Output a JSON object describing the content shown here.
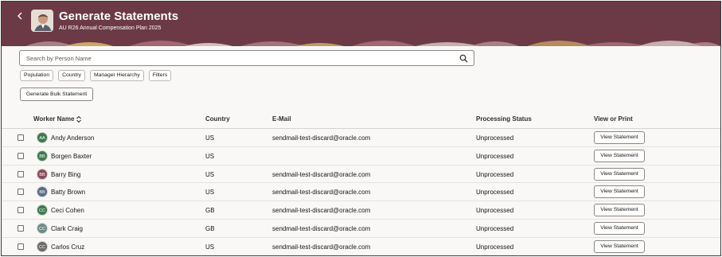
{
  "header": {
    "title": "Generate Statements",
    "subtitle": "AU R26 Annual Compensation Plan 2025",
    "back_icon": "chevron-left-icon",
    "brand_color": "#6b3a46"
  },
  "search": {
    "placeholder": "Search by Person Name",
    "icon": "search-icon"
  },
  "filters": [
    "Population",
    "Country",
    "Manager Hierarchy",
    "Filters"
  ],
  "bulk_button_label": "Generate Bulk Statement",
  "table": {
    "columns": {
      "worker_name": "Worker Name",
      "country": "Country",
      "email": "E-Mail",
      "status": "Processing Status",
      "view": "View or Print"
    },
    "rows": [
      {
        "initials": "AA",
        "name": "Andy Anderson",
        "country": "US",
        "email": "sendmail-test-discard@oracle.com",
        "status": "Unprocessed",
        "action": "View Statement",
        "avatar_color": "#3f7a4f"
      },
      {
        "initials": "BB",
        "name": "Borgen Baxter",
        "country": "US",
        "email": "",
        "status": "Unprocessed",
        "action": "View Statement",
        "avatar_color": "#3f7a4f"
      },
      {
        "initials": "BB",
        "name": "Barry Bing",
        "country": "US",
        "email": "sendmail-test-discard@oracle.com",
        "status": "Unprocessed",
        "action": "View Statement",
        "avatar_color": "#8a4a5a"
      },
      {
        "initials": "BB",
        "name": "Batty Brown",
        "country": "US",
        "email": "sendmail-test-discard@oracle.com",
        "status": "Unprocessed",
        "action": "View Statement",
        "avatar_color": "#5a6a8a"
      },
      {
        "initials": "CC",
        "name": "Ceci Cohen",
        "country": "GB",
        "email": "sendmail-test-discard@oracle.com",
        "status": "Unprocessed",
        "action": "View Statement",
        "avatar_color": "#3f7a4f"
      },
      {
        "initials": "CC",
        "name": "Clark Craig",
        "country": "GB",
        "email": "sendmail-test-discard@oracle.com",
        "status": "Unprocessed",
        "action": "View Statement",
        "avatar_color": "#6f8a86"
      },
      {
        "initials": "CC",
        "name": "Carlos Cruz",
        "country": "US",
        "email": "sendmail-test-discard@oracle.com",
        "status": "Unprocessed",
        "action": "View Statement",
        "avatar_color": "#6a6a6a"
      }
    ]
  }
}
